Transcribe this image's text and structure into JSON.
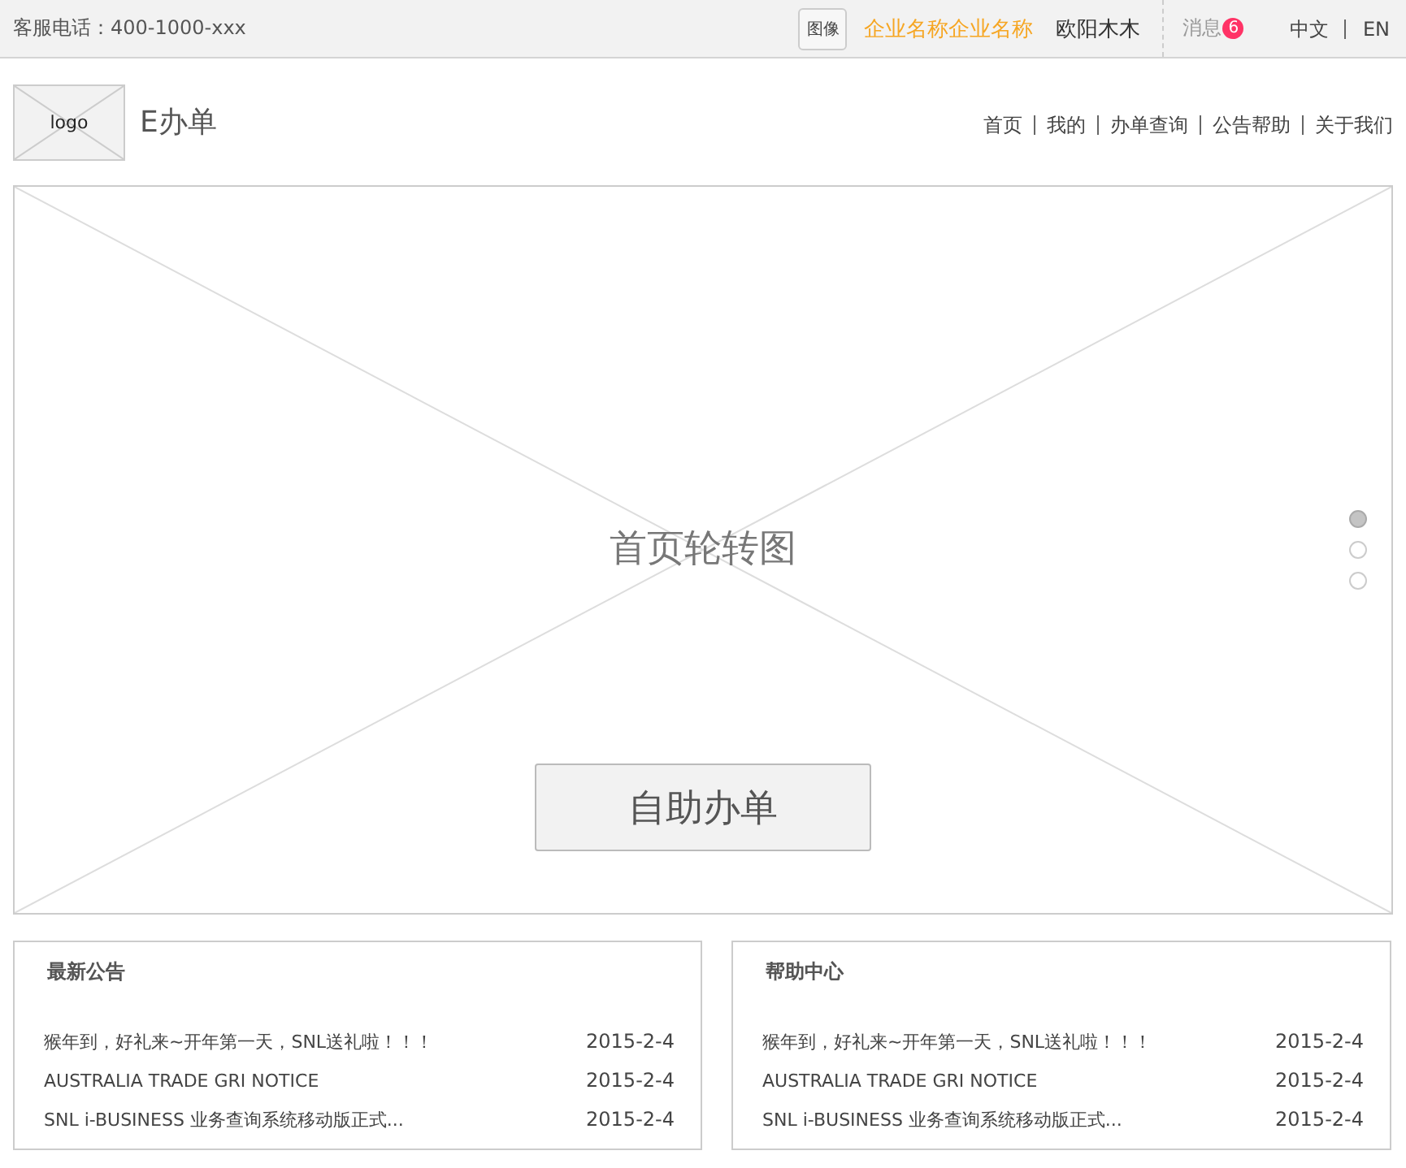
{
  "top_bar": {
    "hotline": "客服电话：400-1000-xxx",
    "avatar": "图像",
    "company": "企业名称企业名称",
    "user": "欧阳木木",
    "messages": {
      "label": "消息",
      "count": "6"
    },
    "languages": [
      {
        "label": "中文",
        "selected": false
      },
      {
        "label": "EN",
        "selected": false
      }
    ]
  },
  "header": {
    "logo": "logo",
    "brand": "E办单",
    "nav": [
      {
        "label": "首页"
      },
      {
        "label": "我的"
      },
      {
        "label": "办单查询"
      },
      {
        "label": "公告帮助"
      },
      {
        "label": "关于我们"
      }
    ]
  },
  "banner": {
    "caption": "首页轮转图",
    "button": "自助办单",
    "dots": [
      {
        "selected": true
      },
      {
        "selected": false
      },
      {
        "selected": false
      }
    ]
  },
  "panels": [
    {
      "title": "最新公告",
      "items": [
        {
          "text": "猴年到，好礼来~开年第一天，SNL送礼啦！！！",
          "date": "2015-2-4"
        },
        {
          "text": "AUSTRALIA TRADE GRI NOTICE",
          "date": "2015-2-4"
        },
        {
          "text": "SNL i-BUSINESS 业务查询系统移动版正式...",
          "date": "2015-2-4"
        }
      ]
    },
    {
      "title": "帮助中心",
      "items": [
        {
          "text": "猴年到，好礼来~开年第一天，SNL送礼啦！！！",
          "date": "2015-2-4"
        },
        {
          "text": "AUSTRALIA TRADE GRI NOTICE",
          "date": "2015-2-4"
        },
        {
          "text": "SNL i-BUSINESS 业务查询系统移动版正式...",
          "date": "2015-2-4"
        }
      ]
    }
  ]
}
